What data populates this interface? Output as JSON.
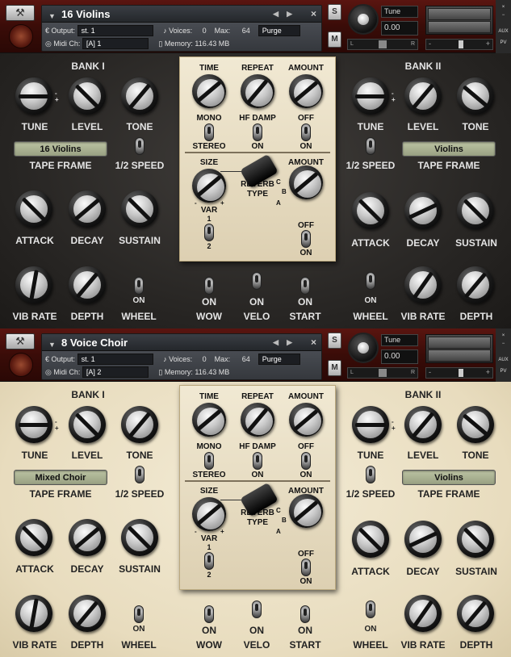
{
  "instruments": [
    {
      "name": "16 Violins",
      "output_label": "Output:",
      "output": "st. 1",
      "voices_label": "Voices:",
      "voices": "0",
      "max_label": "Max:",
      "max": "64",
      "purge": "Purge",
      "midi_label": "Midi Ch:",
      "midi": "[A] 1",
      "memory_label": "Memory:",
      "memory": "116.43 MB",
      "tune_label": "Tune",
      "tune_value": "0.00",
      "s_label": "S",
      "m_label": "M",
      "aux": "AUX",
      "pv": "PV",
      "theme": "dark",
      "bank1": {
        "title": "BANK I",
        "tape_frame": "16 Violins"
      },
      "bank2": {
        "title": "BANK II",
        "tape_frame": "Violins"
      }
    },
    {
      "name": "8 Voice Choir",
      "output_label": "Output:",
      "output": "st. 1",
      "voices_label": "Voices:",
      "voices": "0",
      "max_label": "Max:",
      "max": "64",
      "purge": "Purge",
      "midi_label": "Midi Ch:",
      "midi": "[A] 2",
      "memory_label": "Memory:",
      "memory": "116.43 MB",
      "tune_label": "Tune",
      "tune_value": "0.00",
      "s_label": "S",
      "m_label": "M",
      "aux": "AUX",
      "pv": "PV",
      "theme": "cream",
      "bank1": {
        "title": "BANK I",
        "tape_frame": "Mixed Choir"
      },
      "bank2": {
        "title": "BANK II",
        "tape_frame": "Violins"
      }
    }
  ],
  "labels": {
    "tune": "TUNE",
    "level": "LEVEL",
    "tone": "TONE",
    "tape_frame": "TAPE FRAME",
    "half_speed": "1/2 SPEED",
    "attack": "ATTACK",
    "decay": "DECAY",
    "sustain": "SUSTAIN",
    "vib_rate": "VIB RATE",
    "depth": "DEPTH",
    "wheel": "WHEEL",
    "wow": "WOW",
    "velo": "VELO",
    "start": "START",
    "on": "ON",
    "time": "TIME",
    "repeat": "REPEAT",
    "amount": "AMOUNT",
    "mono": "MONO",
    "stereo": "STEREO",
    "hf_damp": "HF DAMP",
    "off": "OFF",
    "size": "SIZE",
    "reverb_type": "REVERB\nTYPE",
    "var": "VAR",
    "one": "1",
    "two": "2",
    "a": "A",
    "b": "B",
    "c": "C",
    "minus": "-",
    "plus": "+",
    "l": "L",
    "r": "R"
  }
}
